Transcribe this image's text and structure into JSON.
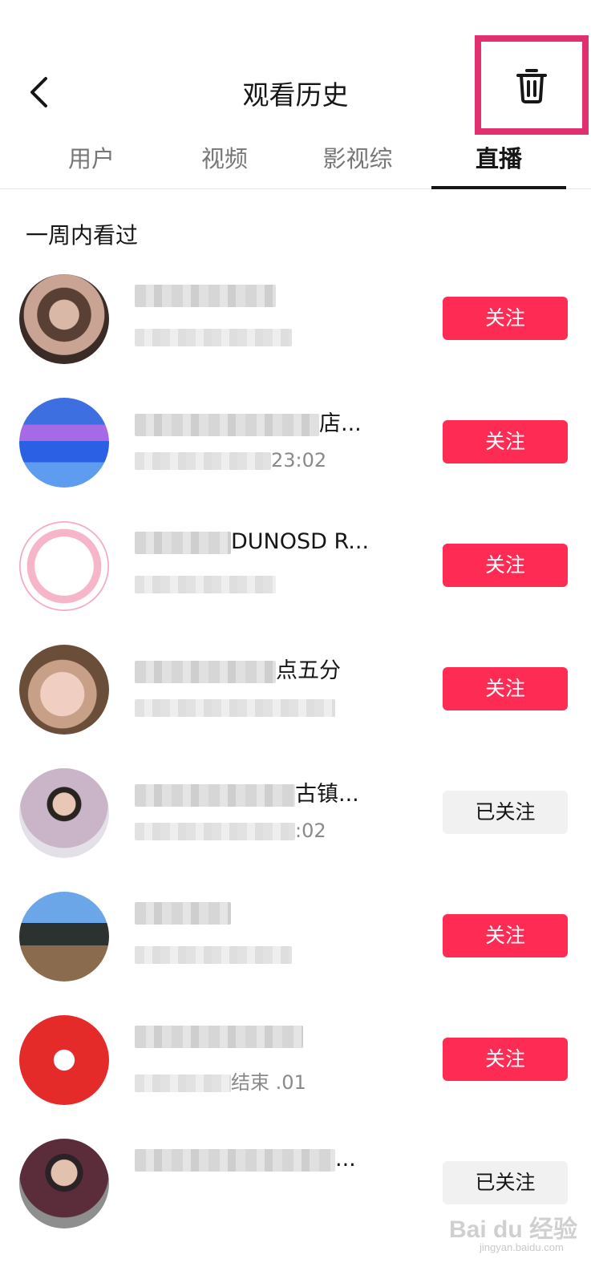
{
  "header": {
    "title": "观看历史",
    "back_icon": "chevron-left-icon",
    "delete_icon": "trash-icon",
    "highlight_color": "#e0306f"
  },
  "tabs": [
    {
      "label": "用户",
      "active": false
    },
    {
      "label": "视频",
      "active": false
    },
    {
      "label": "影视综",
      "active": false
    },
    {
      "label": "直播",
      "active": true
    }
  ],
  "section": {
    "label": "一周内看过"
  },
  "colors": {
    "follow_bg": "#fe2c55",
    "followed_bg": "#f1f1f2",
    "text": "#161616",
    "muted": "#8a8a8a"
  },
  "items": [
    {
      "name_visible": "",
      "sub_visible": "",
      "button": "关注",
      "followed": false
    },
    {
      "name_visible": "店...",
      "sub_visible": "23:02",
      "button": "关注",
      "followed": false
    },
    {
      "name_visible": "DUNOSD R...",
      "sub_visible": "",
      "button": "关注",
      "followed": false
    },
    {
      "name_visible": "点五分",
      "sub_visible": "",
      "button": "关注",
      "followed": false
    },
    {
      "name_visible": "古镇...",
      "sub_visible": ":02",
      "button": "已关注",
      "followed": true
    },
    {
      "name_visible": "",
      "sub_visible": "",
      "button": "关注",
      "followed": false
    },
    {
      "name_visible": "",
      "sub_visible": "结束 .01",
      "button": "关注",
      "followed": false
    },
    {
      "name_visible": "...",
      "sub_visible": "",
      "button": "已关注",
      "followed": true
    }
  ],
  "watermark": {
    "text": "Bai du 经验",
    "sub": "jingyan.baidu.com"
  }
}
